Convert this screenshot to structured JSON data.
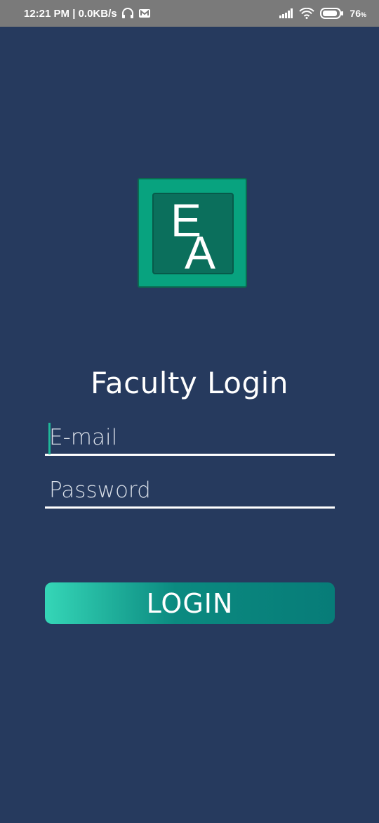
{
  "status_bar": {
    "time_info": "12:21 PM | 0.0KB/s",
    "battery_percent": "76",
    "battery_unit": "%",
    "icons": [
      "headphones-icon",
      "m-app-icon",
      "signal-icon",
      "wifi-icon",
      "battery-icon"
    ]
  },
  "logo": {
    "letter_top": "E",
    "letter_bottom": "A",
    "colors": {
      "outer": "#08a37f",
      "inner": "#0b6f5c"
    }
  },
  "title": "Faculty Login",
  "form": {
    "email_placeholder": "E-mail",
    "password_placeholder": "Password",
    "login_label": "LOGIN"
  },
  "colors": {
    "background": "#263a5e",
    "accent": "#0b8a80",
    "accent_light": "#35d6b7"
  }
}
